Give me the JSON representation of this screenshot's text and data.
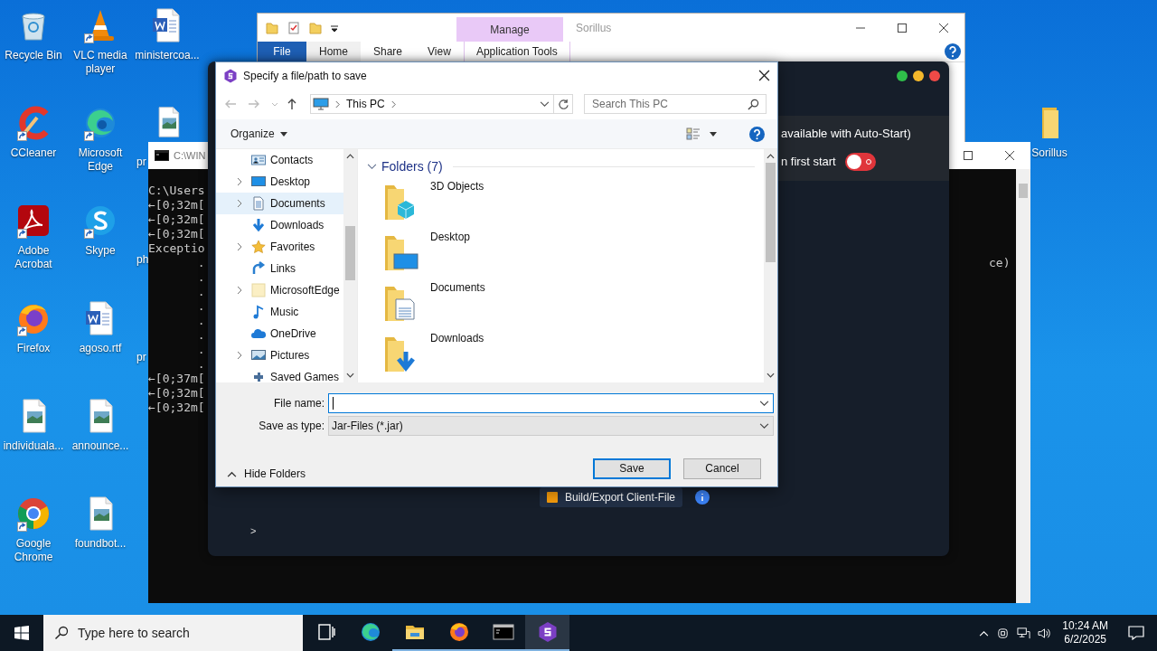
{
  "desktop": {
    "icons": [
      {
        "label": "Recycle Bin",
        "kind": "recycle",
        "shortcut": false,
        "clipped": false
      },
      {
        "label": "CCleaner",
        "kind": "ccleaner",
        "shortcut": true,
        "clipped": false
      },
      {
        "label": "Adobe Acrobat",
        "kind": "acrobat",
        "shortcut": true,
        "clipped": false
      },
      {
        "label": "Firefox",
        "kind": "firefox",
        "shortcut": true,
        "clipped": false
      },
      {
        "label": "individuala...",
        "kind": "image",
        "shortcut": false,
        "clipped": false
      },
      {
        "label": "Google Chrome",
        "kind": "chrome",
        "shortcut": true,
        "clipped": false
      },
      {
        "label": "VLC media player",
        "kind": "vlc",
        "shortcut": true,
        "clipped": false
      },
      {
        "label": "Microsoft Edge",
        "kind": "edge",
        "shortcut": true,
        "clipped": false
      },
      {
        "label": "Skype",
        "kind": "skype",
        "shortcut": true,
        "clipped": false
      },
      {
        "label": "agoso.rtf",
        "kind": "word",
        "shortcut": false,
        "clipped": false
      },
      {
        "label": "announce...",
        "kind": "image",
        "shortcut": false,
        "clipped": false
      },
      {
        "label": "foundbot...",
        "kind": "image",
        "shortcut": false,
        "clipped": false
      },
      {
        "label": "ministercoa...",
        "kind": "word",
        "shortcut": false,
        "clipped": false
      },
      {
        "label": "pr",
        "kind": "image",
        "shortcut": false,
        "clipped": true
      },
      {
        "label": "ph",
        "kind": "none",
        "shortcut": false,
        "clipped": true
      },
      {
        "label": "pr",
        "kind": "none",
        "shortcut": false,
        "clipped": true
      }
    ],
    "right_icons": [
      {
        "label": "Sorillus",
        "kind": "folder",
        "shortcut": false,
        "clipped": false
      }
    ]
  },
  "explorer": {
    "context_tab": "Manage",
    "title": "Sorillus",
    "tabs": [
      {
        "label": "File",
        "kind": "file",
        "selected": false
      },
      {
        "label": "Home",
        "kind": "tab",
        "selected": true
      },
      {
        "label": "Share",
        "kind": "tab",
        "selected": false
      },
      {
        "label": "View",
        "kind": "tab",
        "selected": false
      },
      {
        "label": "Application Tools",
        "kind": "context",
        "selected": false
      }
    ]
  },
  "console": {
    "title": "C:\\WIN",
    "left_lines": [
      "C:\\Users",
      "←[0;32m[",
      "←[0;32m[",
      "←[0;32m[",
      "Exceptio",
      "       .",
      "       .",
      "       .",
      "       .",
      "       .",
      "       .",
      "       .",
      "       .",
      "←[0;37m[",
      "←[0;32m[",
      "←[0;32m["
    ],
    "right_lines": [
      "ce)"
    ]
  },
  "app": {
    "autostart_note": "available with Auto-Start)",
    "first_start": {
      "label": "n first start",
      "on": false
    },
    "build_button": "Build/Export Client-File",
    "prompt": ">"
  },
  "dialog": {
    "title": "Specify a file/path to save",
    "address": "This PC",
    "search_placeholder": "Search This PC",
    "organize": "Organize",
    "nav_items": [
      {
        "label": "Contacts",
        "kind": "contacts",
        "expandable": false,
        "selected": false
      },
      {
        "label": "Desktop",
        "kind": "desktop",
        "expandable": true,
        "selected": false
      },
      {
        "label": "Documents",
        "kind": "documents",
        "expandable": true,
        "selected": true
      },
      {
        "label": "Downloads",
        "kind": "downloads",
        "expandable": false,
        "selected": false
      },
      {
        "label": "Favorites",
        "kind": "favorites",
        "expandable": true,
        "selected": false
      },
      {
        "label": "Links",
        "kind": "links",
        "expandable": false,
        "selected": false
      },
      {
        "label": "MicrosoftEdge",
        "kind": "folder",
        "expandable": true,
        "selected": false
      },
      {
        "label": "Music",
        "kind": "music",
        "expandable": false,
        "selected": false
      },
      {
        "label": "OneDrive",
        "kind": "onedrive",
        "expandable": false,
        "selected": false
      },
      {
        "label": "Pictures",
        "kind": "pictures",
        "expandable": true,
        "selected": false
      },
      {
        "label": "Saved Games",
        "kind": "games",
        "expandable": false,
        "selected": false
      }
    ],
    "group_header": "Folders (7)",
    "folders": [
      {
        "label": "3D Objects",
        "kind": "objects"
      },
      {
        "label": "Desktop",
        "kind": "desktop"
      },
      {
        "label": "Documents",
        "kind": "documents"
      },
      {
        "label": "Downloads",
        "kind": "downloads"
      }
    ],
    "file_name_label": "File name:",
    "type_label": "Save as type:",
    "type_value": "Jar-Files (*.jar)",
    "hide_folders": "Hide Folders",
    "save": "Save",
    "cancel": "Cancel"
  },
  "taskbar": {
    "search_placeholder": "Type here to search",
    "apps": [
      {
        "kind": "taskview",
        "running": false,
        "selected": false
      },
      {
        "kind": "edge",
        "running": false,
        "selected": false
      },
      {
        "kind": "explorer",
        "running": true,
        "selected": false
      },
      {
        "kind": "firefox",
        "running": true,
        "selected": false
      },
      {
        "kind": "console",
        "running": true,
        "selected": false
      },
      {
        "kind": "sorillus",
        "running": true,
        "selected": true
      }
    ],
    "time": "10:24 AM",
    "date": "6/2/2025"
  }
}
